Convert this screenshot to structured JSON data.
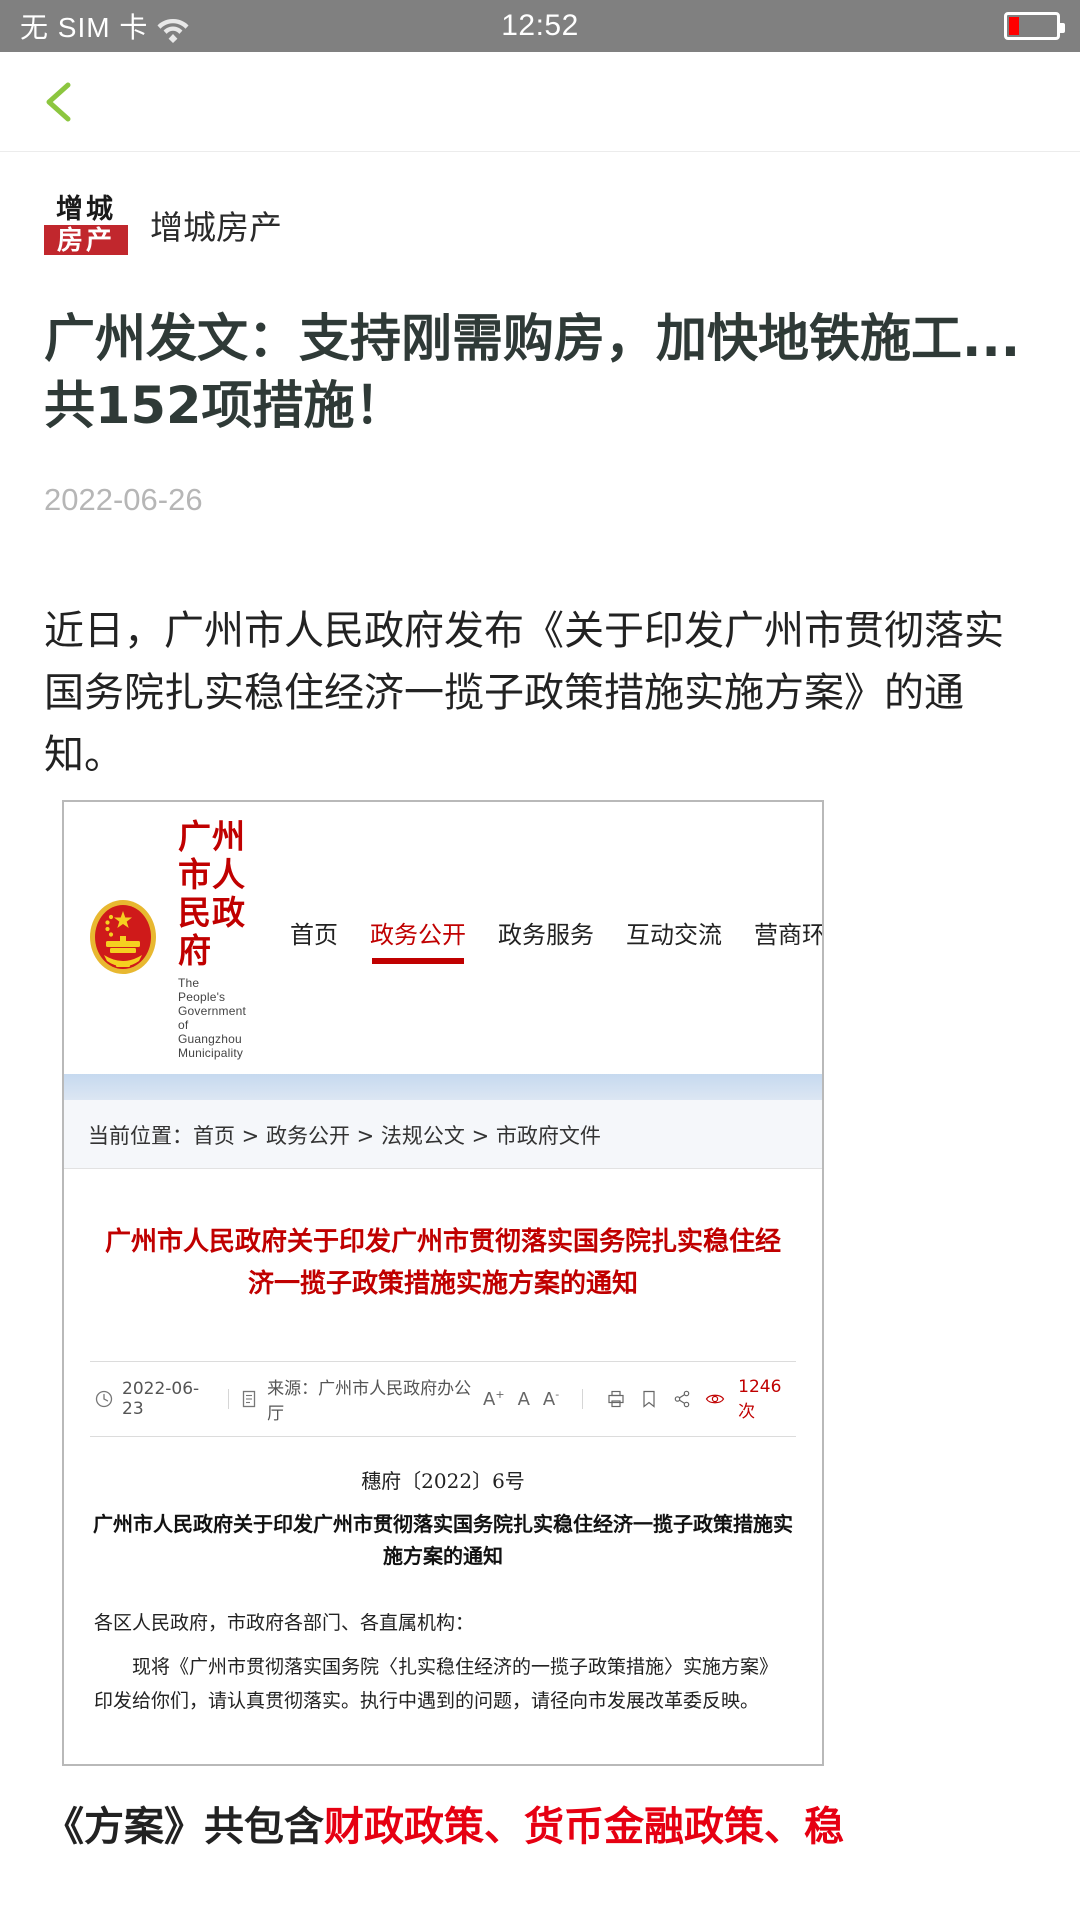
{
  "status_bar": {
    "carrier": "无 SIM 卡",
    "wifi_icon": "wifi-icon",
    "time": "12:52",
    "battery_icon": "battery-icon",
    "battery_level_percent": 22,
    "background_color": "#808080",
    "text_color": "#ffffff"
  },
  "nav": {
    "back_icon": "back-chevron-icon",
    "back_icon_color": "#8cc63f"
  },
  "account": {
    "logo_top_text": "增城",
    "logo_bottom_text": "房产",
    "logo_red": "#c1272d",
    "name": "增城房产"
  },
  "article": {
    "headline": "广州发文：支持刚需购房，加快地铁施工...共152项措施！",
    "date": "2022-06-26",
    "paragraph_1": "近日，广州市人民政府发布《关于印发广州市贯彻落实国务院扎实稳住经济一揽子政策措施实施方案》的通知。",
    "closing_prefix": "《方案》共包含",
    "closing_highlight": "财政政策、货币金融政策、稳",
    "highlight_color": "#e60012"
  },
  "embedded_screenshot": {
    "gov_site": {
      "emblem_icon": "national-emblem-icon",
      "title_cn": "广州市人民政府",
      "title_en": "The People's Government of Guangzhou Municipality",
      "title_color": "#c00000",
      "nav_items": [
        {
          "label": "首页",
          "active": false
        },
        {
          "label": "政务公开",
          "active": true
        },
        {
          "label": "政务服务",
          "active": false
        },
        {
          "label": "互动交流",
          "active": false
        },
        {
          "label": "营商环境",
          "active": false
        }
      ],
      "breadcrumb": "当前位置：首页 > 政务公开 > 法规公文 > 市政府文件"
    },
    "document": {
      "red_title_line_1": "广州市人民政府关于印发广州市贯彻落实国务院扎实稳住经",
      "red_title_line_2": "济一揽子政策措施实施方案的通知",
      "red_title_color": "#c00000",
      "meta": {
        "clock_icon": "clock-icon",
        "date": "2022-06-23",
        "doc-icon": "document-icon",
        "source": "来源：广州市人民政府办公厅",
        "font_larger": "A",
        "font_normal": "A",
        "font_smaller": "A",
        "print_icon": "print-icon",
        "save_icon": "save-icon",
        "share_icon": "share-icon",
        "eye_icon": "eye-icon",
        "view_count": "1246次",
        "view_count_color": "#c00000"
      },
      "doc_number": "穗府〔2022〕6号",
      "doc_heading": "广州市人民政府关于印发广州市贯彻落实国务院扎实稳住经济一揽子政策措施实施方案的通知",
      "salutation": "各区人民政府，市政府各部门、各直属机构：",
      "paragraph_1": "现将《广州市贯彻落实国务院〈扎实稳住经济的一揽子政策措施〉实施方案》印发给你们，请认真贯彻落实。执行中遇到的问题，请径向市发展改革委反映。"
    }
  }
}
